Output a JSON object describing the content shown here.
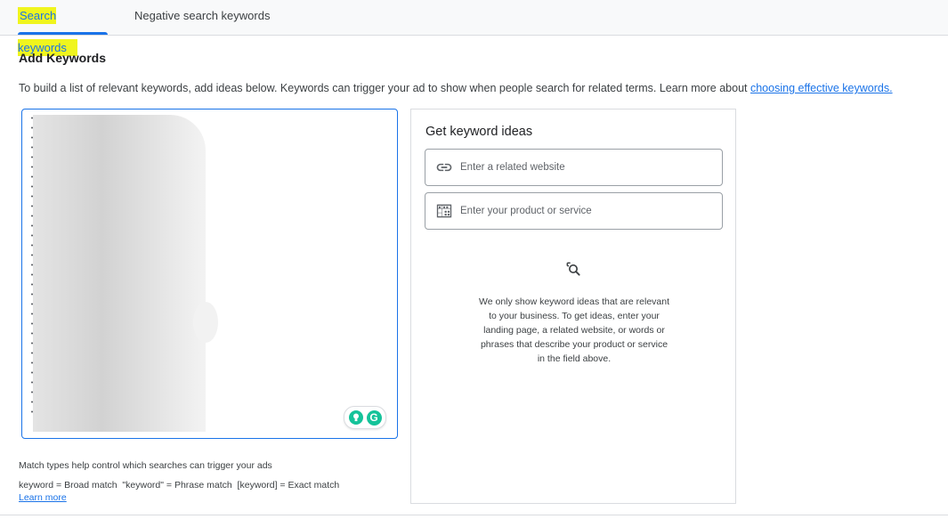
{
  "tabs": {
    "search": "Search keywords",
    "negative": "Negative search keywords"
  },
  "section": {
    "title": "Add Keywords",
    "intro": "To build a list of relevant keywords, add ideas below. Keywords can trigger your ad to show when people search for related terms. Learn more about ",
    "intro_link": "choosing effective keywords."
  },
  "keyword_box": {
    "grammarly_label": "G"
  },
  "match": {
    "help": "Match types help control which searches can trigger your ads",
    "types": "keyword = Broad match  \"keyword\" = Phrase match  [keyword] = Exact match",
    "learn_more": "Learn more"
  },
  "ideas": {
    "title": "Get keyword ideas",
    "website_placeholder": "Enter a related website",
    "product_placeholder": "Enter your product or service",
    "note": "We only show keyword ideas that are relevant to your business. To get ideas, enter your landing page, a related website, or words or phrases that describe your product or service in the field above."
  },
  "colors": {
    "accent": "#1a73e8",
    "highlight": "#f0f51e",
    "grammarly": "#15c39a"
  }
}
